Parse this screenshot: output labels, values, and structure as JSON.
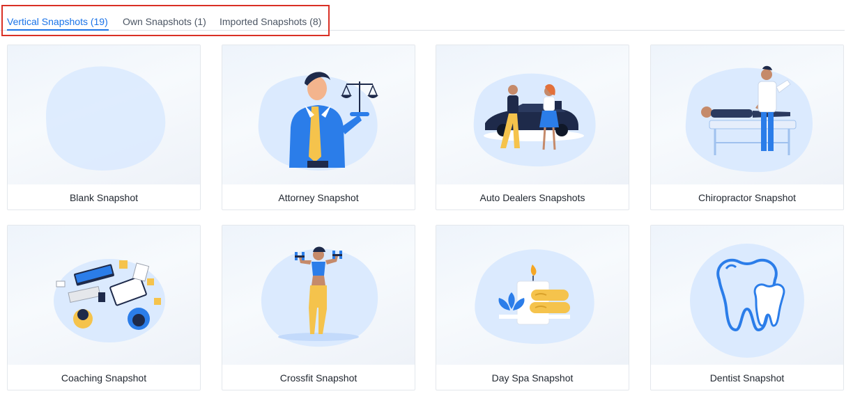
{
  "tabs": [
    {
      "label": "Vertical Snapshots (19)",
      "active": true
    },
    {
      "label": "Own Snapshots (1)",
      "active": false
    },
    {
      "label": "Imported Snapshots (8)",
      "active": false
    }
  ],
  "cards": [
    {
      "label": "Blank Snapshot",
      "icon": "blank-blob-icon"
    },
    {
      "label": "Attorney Snapshot",
      "icon": "lawyer-with-scales-icon"
    },
    {
      "label": "Auto Dealers Snapshots",
      "icon": "car-dealer-icon"
    },
    {
      "label": "Chiropractor Snapshot",
      "icon": "chiropractor-patient-icon"
    },
    {
      "label": "Coaching Snapshot",
      "icon": "coaching-desk-icon"
    },
    {
      "label": "Crossfit Snapshot",
      "icon": "woman-dumbbells-icon"
    },
    {
      "label": "Day Spa Snapshot",
      "icon": "spa-candle-towels-icon"
    },
    {
      "label": "Dentist Snapshot",
      "icon": "teeth-icon"
    }
  ],
  "colors": {
    "accent": "#1a73e8",
    "highlight_border": "#d93025",
    "blob": "#dbeafe",
    "illustration_blue": "#2b7de9",
    "illustration_yellow": "#f5c34c"
  }
}
